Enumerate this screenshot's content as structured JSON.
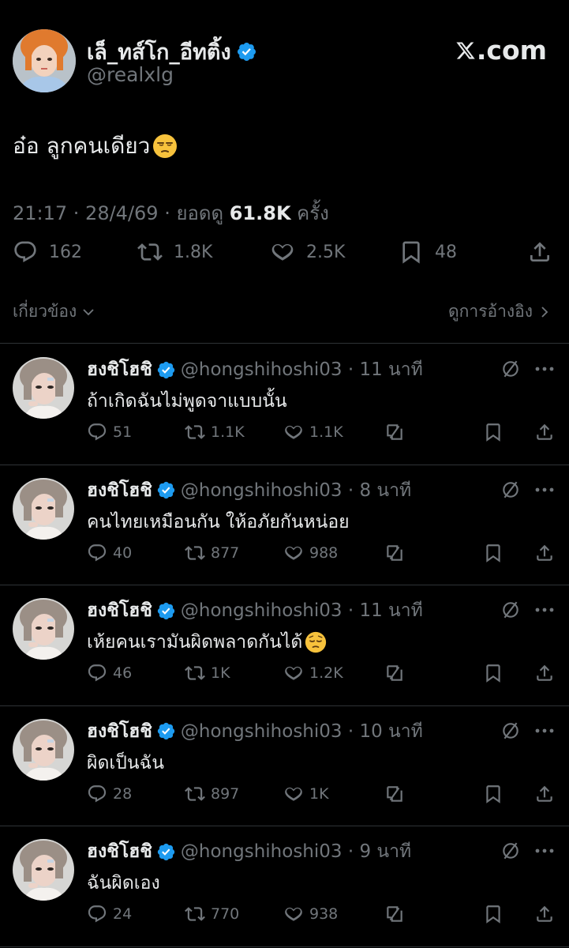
{
  "brand": {
    "label": ".com"
  },
  "tweet": {
    "author_name": "เล็_ทส์โก_อีทติ้ง",
    "author_handle": "@realxlg",
    "text": "อ๋อ ลูกคนเดียว",
    "time": "21:17 · 28/4/69 · ยอดดู ",
    "views": "61.8K",
    "views_unit": " ครั้ง",
    "replies": "162",
    "reposts": "1.8K",
    "likes": "2.5K",
    "bookmarks": "48"
  },
  "sort_label": "เกี่ยวข้อง",
  "quotes_label": "ดูการอ้างอิง",
  "replies": [
    {
      "name": "ฮงชิโฮชิ",
      "handle": "@hongshihoshi03 · 11 นาที",
      "text": "ถ้าเกิดฉันไม่พูดจาแบบนั้น",
      "replies": "51",
      "reposts": "1.1K",
      "likes": "1.1K"
    },
    {
      "name": "ฮงชิโฮชิ",
      "handle": "@hongshihoshi03 · 8 นาที",
      "text": "คนไทยเหมือนกัน ให้อภัยกันหน่อย",
      "replies": "40",
      "reposts": "877",
      "likes": "988"
    },
    {
      "name": "ฮงชิโฮชิ",
      "handle": "@hongshihoshi03 · 11 นาที",
      "text": "เห้ยคนเรามันผิดพลาดกันได้",
      "replies": "46",
      "reposts": "1K",
      "likes": "1.2K"
    },
    {
      "name": "ฮงชิโฮชิ",
      "handle": "@hongshihoshi03 · 10 นาที",
      "text": "ผิดเป็นฉัน",
      "replies": "28",
      "reposts": "897",
      "likes": "1K"
    },
    {
      "name": "ฮงชิโฮชิ",
      "handle": "@hongshihoshi03 · 9 นาที",
      "text": "ฉันผิดเอง",
      "replies": "24",
      "reposts": "770",
      "likes": "938"
    }
  ],
  "colors": {
    "background": "#000000",
    "text": "#e7e9ea",
    "muted": "#71767b",
    "verified": "#1d9bf0",
    "divider": "#2f3336"
  },
  "icons": [
    "x-logo-icon",
    "verified-icon",
    "reply-icon",
    "repost-icon",
    "like-icon",
    "bookmark-icon",
    "share-icon",
    "chevron-down-icon",
    "chevron-right-icon",
    "mute-icon",
    "more-icon",
    "grok-icon",
    "unamused-emoji",
    "pensive-emoji"
  ]
}
